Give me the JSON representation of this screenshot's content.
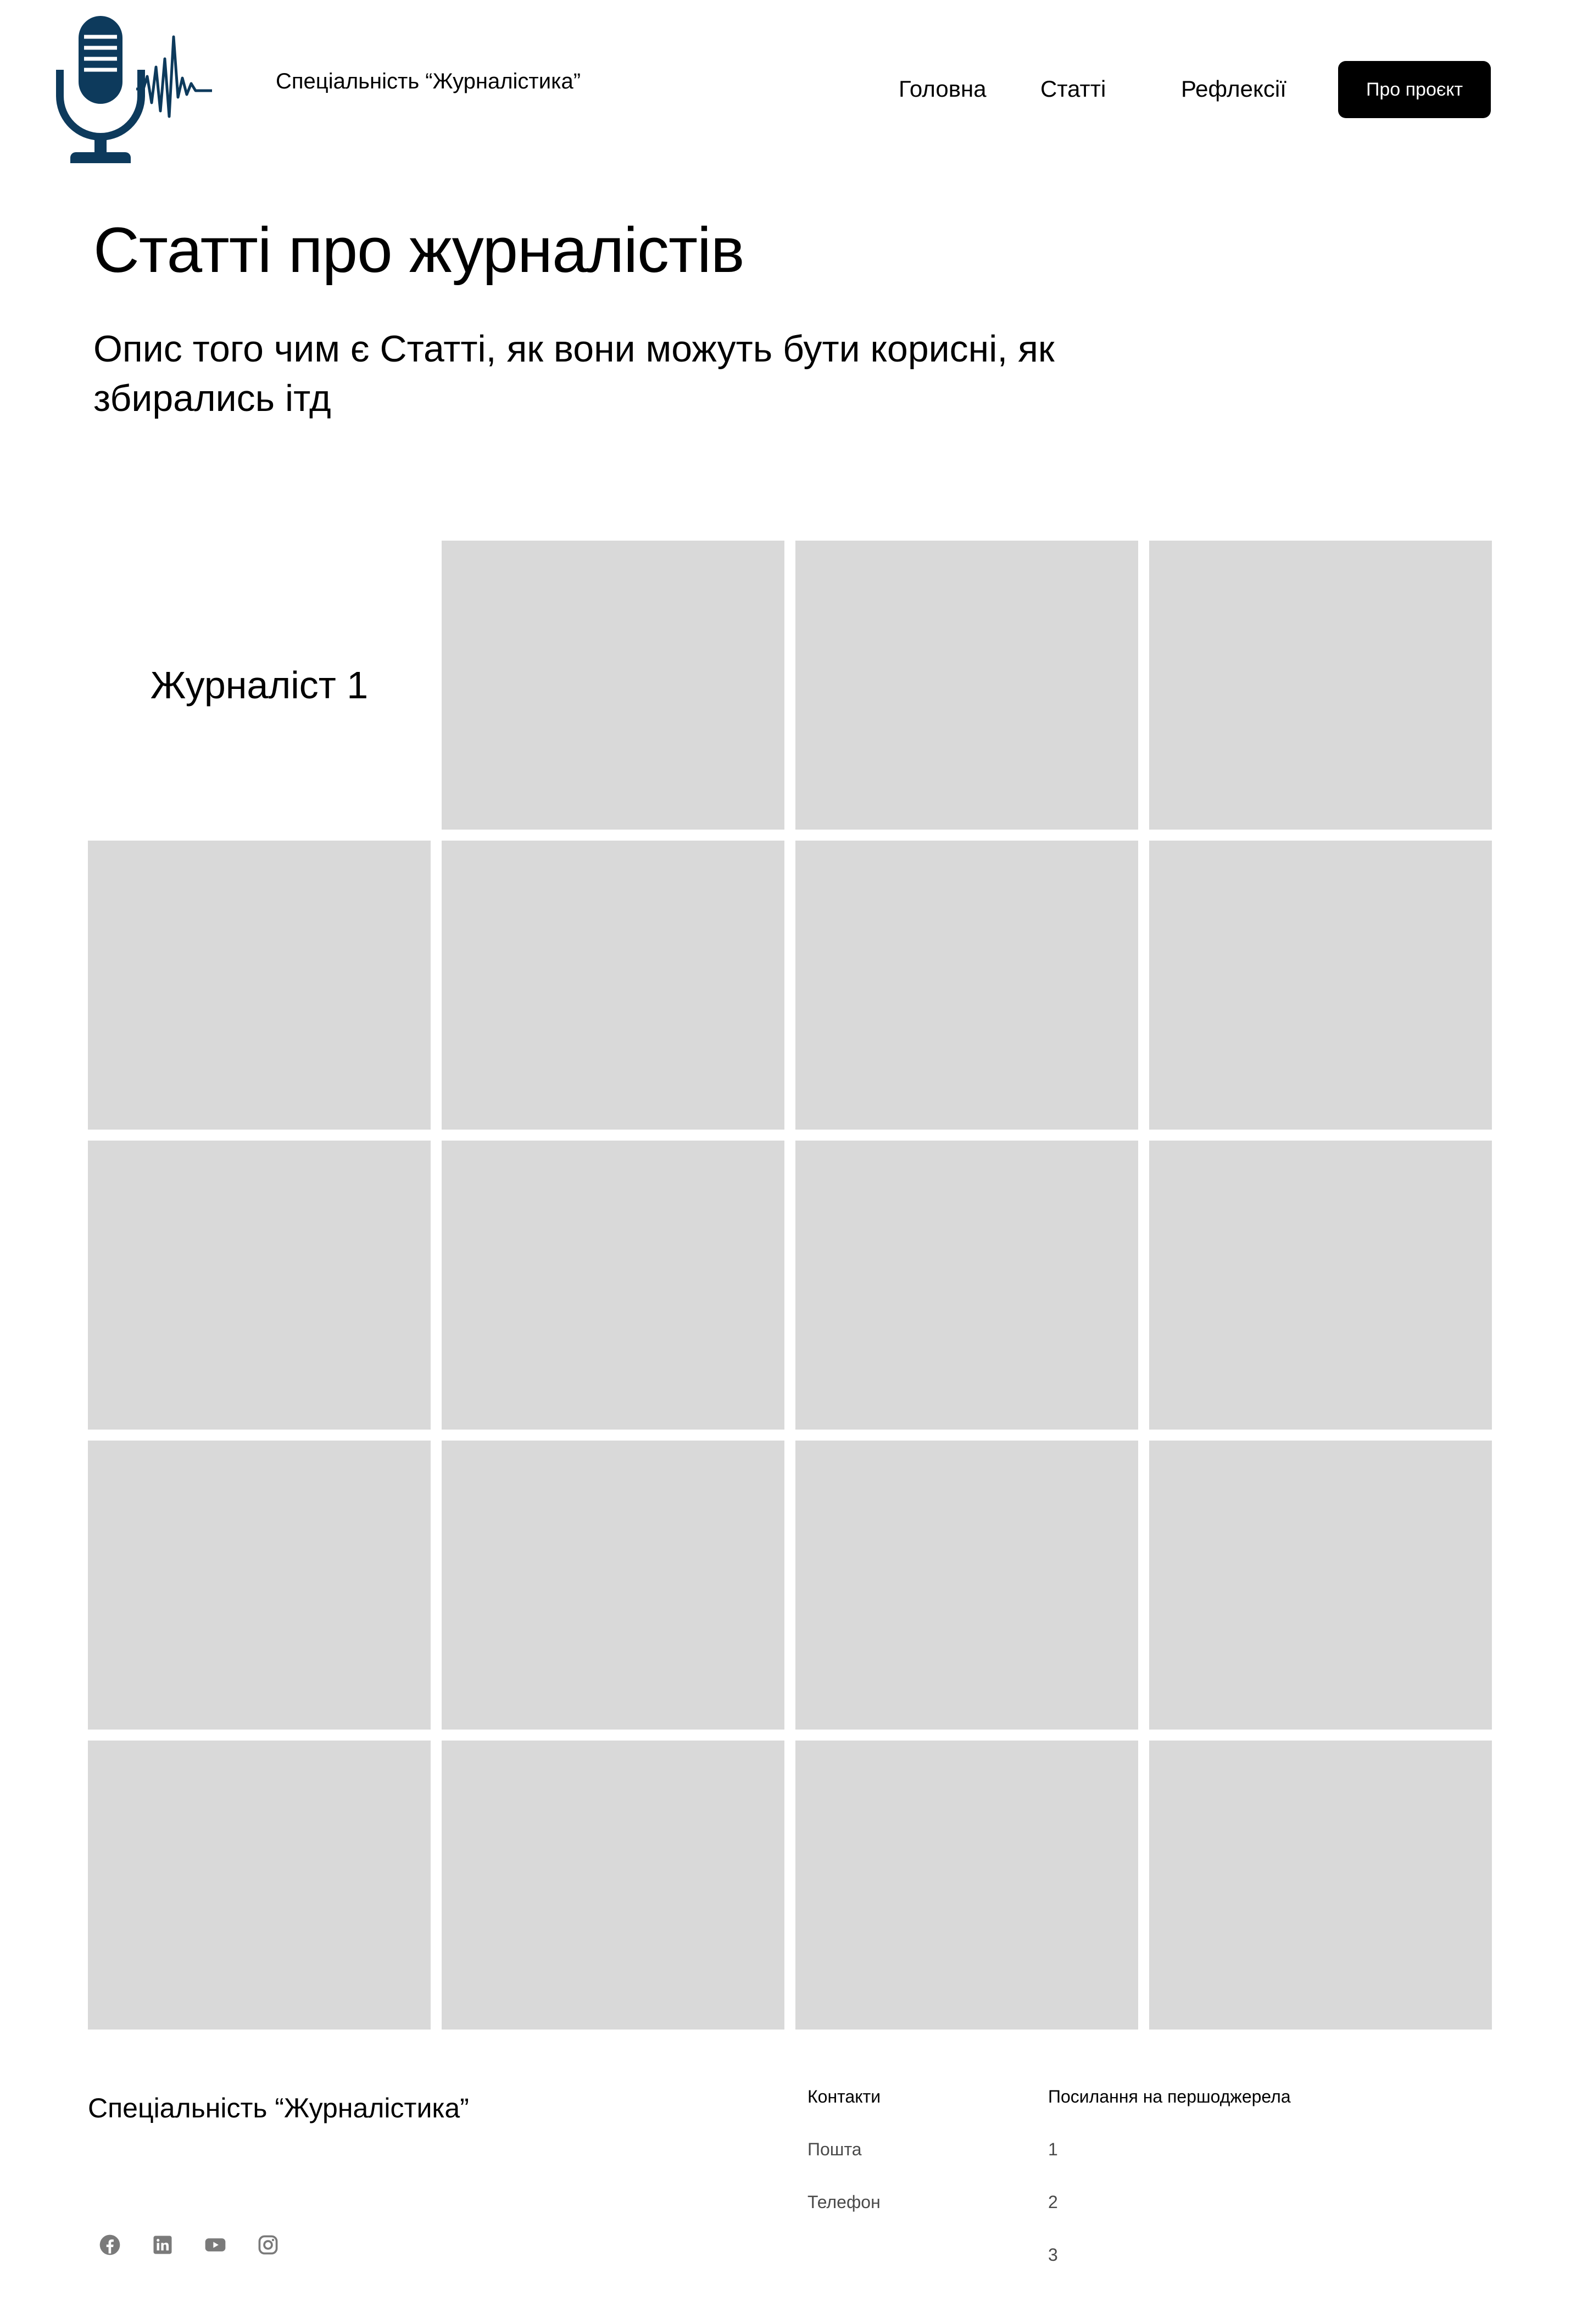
{
  "header": {
    "brand": "Спеціальність “Журналістика”",
    "nav": {
      "home": "Головна",
      "articles": "Статті",
      "reflections": "Рефлексії",
      "about": "Про проєкт"
    },
    "logo_icon": "microphone-waveform-icon",
    "logo_color": "#0d3a5c"
  },
  "hero": {
    "title": "Статті про журналістів",
    "description": "Опис того чим є Статті, як вони можуть бути корисні, як збирались ітд"
  },
  "grid": {
    "label": "Журналіст 1",
    "placeholder_color": "#d9d9d9",
    "placeholder_count": 19
  },
  "footer": {
    "brand": "Спеціальність “Журналістика”",
    "contacts": {
      "heading": "Контакти",
      "items": [
        "Пошта",
        "Телефон"
      ]
    },
    "sources": {
      "heading": "Посилання на першоджерела",
      "items": [
        "1",
        "2",
        "3"
      ]
    },
    "socials": [
      "facebook-icon",
      "linkedin-icon",
      "youtube-icon",
      "instagram-icon"
    ],
    "social_icon_color": "#7a7a7a"
  }
}
